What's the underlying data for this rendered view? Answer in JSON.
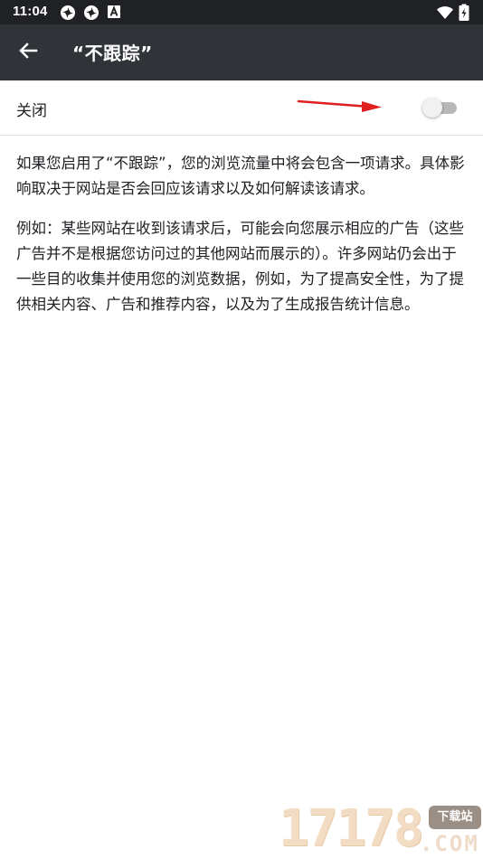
{
  "status_bar": {
    "time": "11:04",
    "left_icons": [
      "pinwheel-icon",
      "pinwheel-icon",
      "a-box-icon"
    ],
    "right_icons": [
      "wifi-icon",
      "battery-charging-icon"
    ]
  },
  "app_bar": {
    "back_icon": "arrow-left-icon",
    "title": "“不跟踪”"
  },
  "toggle": {
    "label": "关闭",
    "enabled": false
  },
  "content": {
    "paragraphs": [
      "如果您启用了“不跟踪”，您的浏览流量中将会包含一项请求。具体影响取决于网站是否会回应该请求以及如何解读该请求。",
      "例如：某些网站在收到该请求后，可能会向您展示相应的广告（这些广告并不是根据您访问过的其他网站而展示的）。许多网站仍会出于一些目的收集并使用您的浏览数据，例如，为了提高安全性，为了提供相关内容、广告和推荐内容，以及为了生成报告统计信息。"
    ]
  },
  "watermark": {
    "digits": "17178",
    "badge": "下载站",
    "domain": ".COM"
  },
  "colors": {
    "status_bar_bg": "#202124",
    "app_bar_bg": "#303439",
    "annotation_arrow": "#e02020"
  }
}
